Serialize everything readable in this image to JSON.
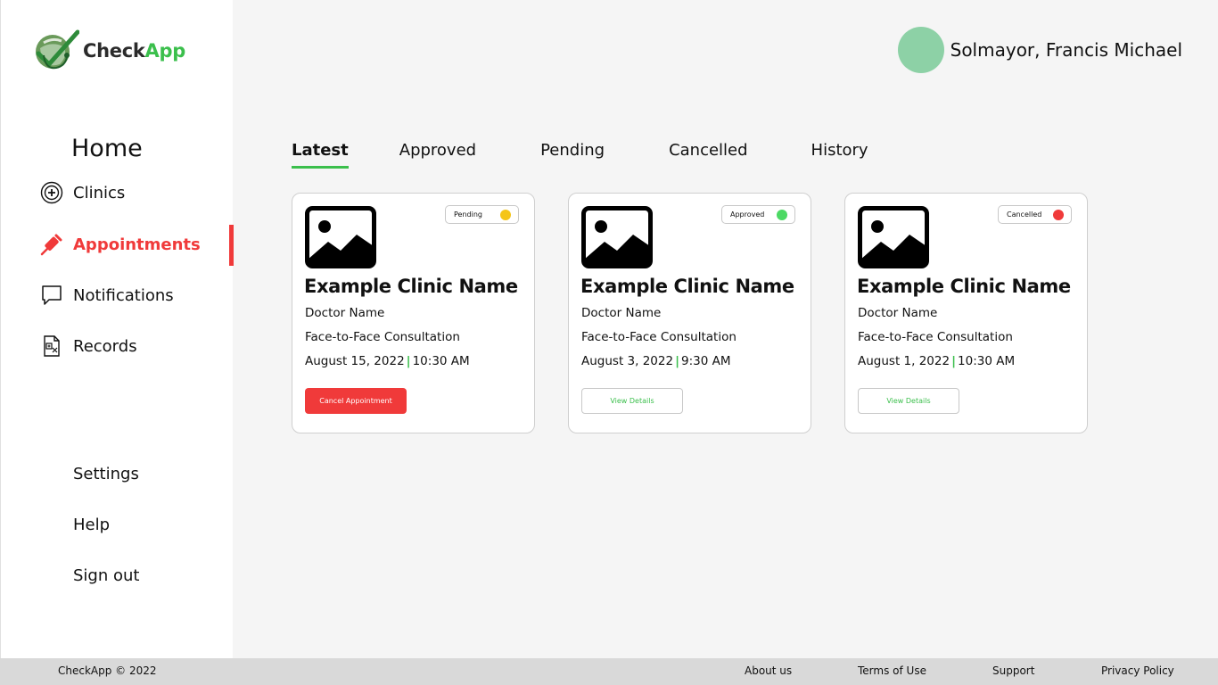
{
  "brand": {
    "name_part1": "Check",
    "name_part2": "App"
  },
  "user": {
    "name": "Solmayor, Francis Michael"
  },
  "sidebar": {
    "home": "Home",
    "items": [
      {
        "label": "Clinics",
        "icon": "clinic-icon"
      },
      {
        "label": "Appointments",
        "icon": "syringe-icon",
        "active": true
      },
      {
        "label": "Notifications",
        "icon": "chat-bubble-icon"
      },
      {
        "label": "Records",
        "icon": "records-icon"
      }
    ],
    "bottom": [
      "Settings",
      "Help",
      "Sign out"
    ]
  },
  "tabs": [
    "Latest",
    "Approved",
    "Pending",
    "Cancelled",
    "History"
  ],
  "active_tab": "Latest",
  "cards": [
    {
      "status": "Pending",
      "status_color": "#f5c518",
      "clinic": "Example Clinic Name",
      "doctor": "Doctor Name",
      "type": "Face-to-Face Consultation",
      "date": "August 15, 2022",
      "time": "10:30 AM",
      "button": "Cancel Appointment"
    },
    {
      "status": "Approved",
      "status_color": "#4cd964",
      "clinic": "Example Clinic Name",
      "doctor": "Doctor Name",
      "type": "Face-to-Face Consultation",
      "date": "August 3, 2022",
      "time": "9:30 AM",
      "button": "View Details"
    },
    {
      "status": "Cancelled",
      "status_color": "#f03a3a",
      "clinic": "Example Clinic Name",
      "doctor": "Doctor Name",
      "type": "Face-to-Face Consultation",
      "date": "August 1, 2022",
      "time": "10:30 AM",
      "button": "View Details"
    }
  ],
  "footer": {
    "copyright": "CheckApp © 2022",
    "links": [
      "About us",
      "Terms of Use",
      "Support",
      "Privacy Policy"
    ]
  },
  "colors": {
    "accent_green": "#3bbf4c",
    "accent_red": "#f03a3a",
    "avatar": "#8dd1a6"
  }
}
